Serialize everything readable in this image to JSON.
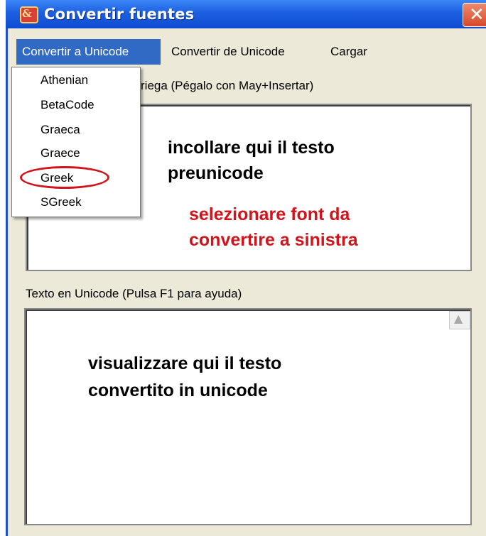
{
  "window": {
    "title": "Convertir fuentes",
    "app_icon_glyph": "&",
    "close_glyph": "✕"
  },
  "menu": {
    "items": [
      "Convertir a Unicode",
      "Convertir de Unicode",
      "Cargar"
    ],
    "active_item": "Convertir a Unicode"
  },
  "dropdown": {
    "items": [
      "Athenian",
      "BetaCode",
      "Graeca",
      "Graece",
      "Greek",
      "SGreek"
    ],
    "highlighted": "Greek"
  },
  "panels": {
    "top_label_visible_part": "riega (Pégalo con May+Insertar)",
    "bottom_label": "Texto en Unicode (Pulsa F1 para ayuda)"
  },
  "annotations": {
    "top_black_line1": "incollare qui il testo",
    "top_black_line2": "preunicode",
    "top_red_line1": "selezionare font da",
    "top_red_line2": "convertire a sinistra",
    "bottom_line1": "visualizzare qui il testo",
    "bottom_line2": "convertito in unicode"
  },
  "icons": {
    "scroll_up": "scroll-up-arrow-icon"
  },
  "colors": {
    "titlebar": "#1c5fe0",
    "menu_highlight": "#316ac5",
    "annotation_red": "#d0141c",
    "window_bg": "#ece9d8"
  }
}
